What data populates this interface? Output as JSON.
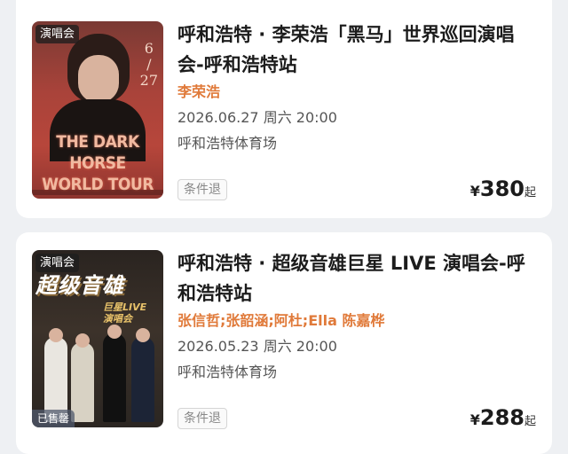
{
  "events": [
    {
      "tag": "演唱会",
      "title": "呼和浩特 · 李荣浩「黑马」世界巡回演唱会-呼和浩特站",
      "artist": "李荣浩",
      "datetime": "2026.06.27 周六 20:00",
      "venue": "呼和浩特体育场",
      "refund": "条件退",
      "price_currency": "¥",
      "price": "380",
      "price_suffix": "起",
      "poster": {
        "tour_line1": "THE DARK HORSE",
        "tour_line2": "WORLD TOUR",
        "date_mark": "6\n/\n27"
      }
    },
    {
      "tag": "演唱会",
      "sold_badge": "已售罄",
      "title": "呼和浩特 · 超级音雄巨星 LIVE 演唱会-呼和浩特站",
      "artist": "张信哲;张韶涵;阿杜;Ella 陈嘉桦",
      "datetime": "2026.05.23 周六 20:00",
      "venue": "呼和浩特体育场",
      "refund": "条件退",
      "price_currency": "¥",
      "price": "288",
      "price_suffix": "起",
      "poster": {
        "banner": "超级音雄",
        "subtitle": "巨星LIVE\n演唱会"
      }
    }
  ],
  "colors": {
    "artist": "#e07a3a",
    "background": "#eef0f3",
    "card": "#ffffff"
  }
}
